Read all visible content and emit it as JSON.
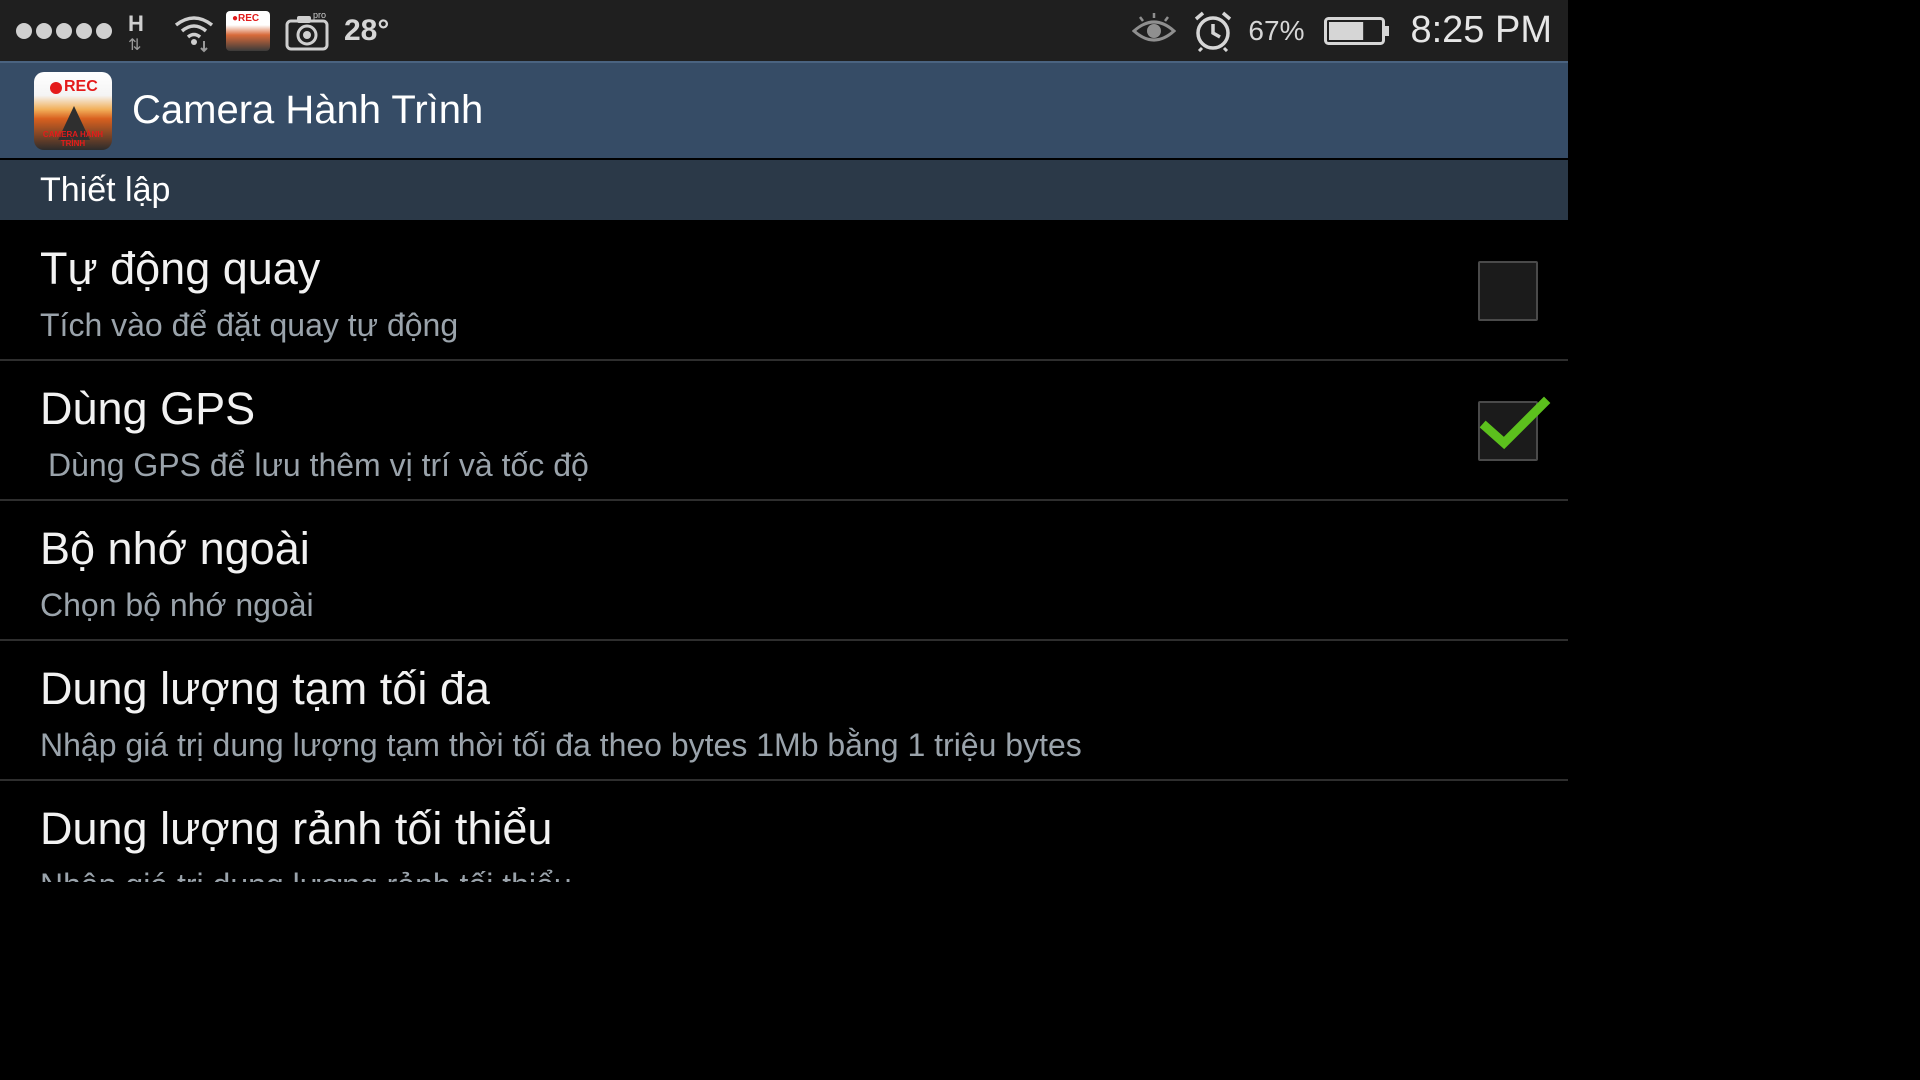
{
  "status_bar": {
    "temperature": "28°",
    "battery_percent": "67%",
    "battery_level": 0.67,
    "time": "8:25 PM",
    "network_type": "H",
    "rec_icon_text": "●REC"
  },
  "app_bar": {
    "title": "Camera Hành Trình",
    "logo_text": "REC",
    "logo_caption": "CAMERA HÀNH TRÌNH"
  },
  "section": {
    "label": "Thiết lập"
  },
  "preferences": [
    {
      "title": "Tự động quay",
      "summary": "Tích vào để đặt quay tự động",
      "checked": false
    },
    {
      "title": "Dùng GPS",
      "summary": "Dùng GPS để lưu thêm vị trí và tốc độ",
      "checked": true
    },
    {
      "title": "Bộ nhớ ngoài",
      "summary": "Chọn bộ nhớ ngoài"
    },
    {
      "title": "Dung lượng tạm tối đa",
      "summary": "Nhập giá trị dung lượng tạm thời tối đa theo bytes 1Mb bằng 1 triệu bytes"
    },
    {
      "title": "Dung lượng rảnh tối thiểu",
      "summary": "Nhập giá trị dung lượng rảnh tối thiểu"
    }
  ],
  "colors": {
    "app_bar": "#364c66",
    "section_header": "#2b3948",
    "check_green": "#5cc01d"
  }
}
